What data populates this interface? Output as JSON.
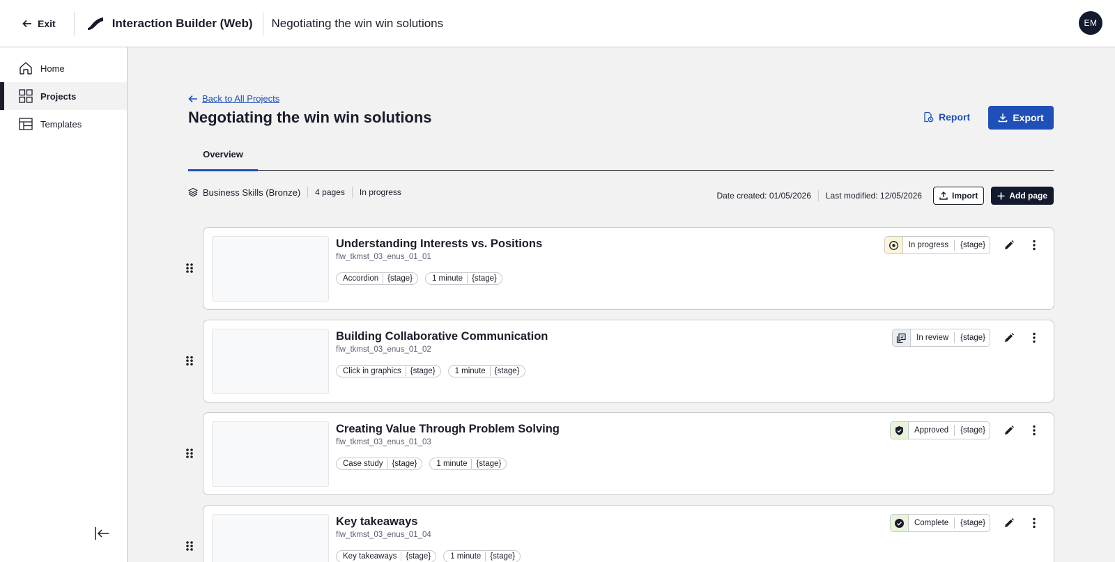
{
  "header": {
    "exit_label": "Exit",
    "app_title": "Interaction Builder (Web)",
    "project_name": "Negotiating the win win solutions",
    "avatar_initials": "EM"
  },
  "sidebar": {
    "items": [
      {
        "label": "Home",
        "icon": "home-icon"
      },
      {
        "label": "Projects",
        "icon": "grid-icon",
        "active": true
      },
      {
        "label": "Templates",
        "icon": "layout-icon"
      }
    ]
  },
  "main": {
    "back_label": "Back to All Projects",
    "title": "Negotiating the win win solutions",
    "report_label": "Report",
    "export_label": "Export",
    "tabs": [
      {
        "label": "Overview",
        "active": true
      }
    ],
    "meta": {
      "course": "Business Skills (Bronze)",
      "pages": "4 pages",
      "status": "In progress",
      "date_created": "Date created: 01/05/2026",
      "last_modified": "Last modified: 12/05/2026",
      "import_label": "Import",
      "add_page_label": "Add page"
    },
    "pages": [
      {
        "title": "Understanding Interests vs. Positions",
        "id": "flw_tkmst_03_enus_01_01",
        "type": "Accordion",
        "type_stage": "{stage}",
        "duration": "1 minute",
        "duration_stage": "{stage}",
        "status": "In progress",
        "status_stage": "{stage}",
        "status_icon": "target-icon"
      },
      {
        "title": "Building Collaborative Communication",
        "id": "flw_tkmst_03_enus_01_02",
        "type": "Click in graphics",
        "type_stage": "{stage}",
        "duration": "1 minute",
        "duration_stage": "{stage}",
        "status": "In review",
        "status_stage": "{stage}",
        "status_icon": "review-icon"
      },
      {
        "title": "Creating Value Through Problem Solving",
        "id": "flw_tkmst_03_enus_01_03",
        "type": "Case study",
        "type_stage": "{stage}",
        "duration": "1 minute",
        "duration_stage": "{stage}",
        "status": "Approved",
        "status_stage": "{stage}",
        "status_icon": "shield-check-icon"
      },
      {
        "title": "Key takeaways",
        "id": "flw_tkmst_03_enus_01_04",
        "type": "Key takeaways",
        "type_stage": "{stage}",
        "duration": "1 minute",
        "duration_stage": "{stage}",
        "status": "Complete",
        "status_stage": "{stage}",
        "status_icon": "check-circle-icon"
      }
    ]
  },
  "colors": {
    "accent": "#1f4fb8",
    "dark": "#141a2e",
    "status_in_progress_bg": "#fdf3d8",
    "status_in_review_bg": "#e9eef6",
    "status_approved_bg": "#e8f4dc",
    "status_complete_bg": "#e8f4dc"
  }
}
